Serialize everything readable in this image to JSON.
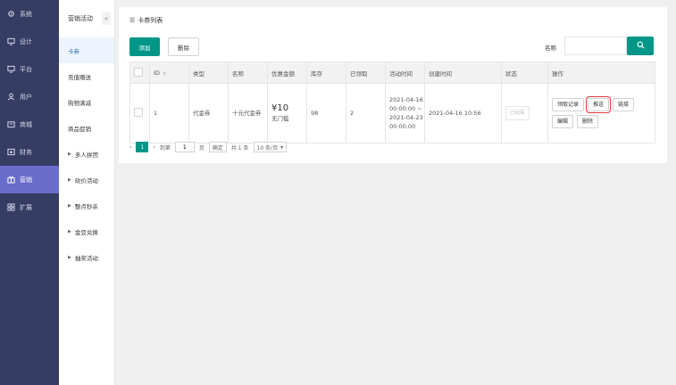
{
  "sidebar": {
    "items": [
      {
        "label": "系统",
        "icon": "gear-icon"
      },
      {
        "label": "设计",
        "icon": "monitor-icon"
      },
      {
        "label": "平台",
        "icon": "monitor-icon"
      },
      {
        "label": "用户",
        "icon": "user-icon"
      },
      {
        "label": "商城",
        "icon": "shop-icon"
      },
      {
        "label": "财务",
        "icon": "wallet-icon"
      },
      {
        "label": "营销",
        "icon": "marketing-icon",
        "active": true
      },
      {
        "label": "扩展",
        "icon": "grid-icon"
      }
    ]
  },
  "subnav": {
    "title": "营销活动",
    "collapse": "«",
    "items": [
      {
        "label": "卡券",
        "active": true,
        "expandable": false
      },
      {
        "label": "充值赠送",
        "expandable": false
      },
      {
        "label": "购物满减",
        "expandable": false
      },
      {
        "label": "商品促销",
        "expandable": false
      },
      {
        "label": "多人拼团",
        "expandable": true
      },
      {
        "label": "砍价活动",
        "expandable": true
      },
      {
        "label": "整点秒杀",
        "expandable": true
      },
      {
        "label": "金豆兑换",
        "expandable": true
      },
      {
        "label": "抽奖活动",
        "expandable": true
      }
    ]
  },
  "main": {
    "title": "卡券列表",
    "add_label": "添加",
    "delete_label": "删除",
    "search_label": "名称",
    "search_value": "",
    "search_placeholder": ""
  },
  "table": {
    "headers": [
      "ID",
      "类型",
      "名称",
      "优惠金额",
      "库存",
      "已领取",
      "活动时间",
      "创建时间",
      "状态",
      "操作"
    ],
    "rows": [
      {
        "id": "1",
        "type": "代金券",
        "name": "十元代金券",
        "amount": "¥10",
        "condition": "无门槛",
        "stock": "98",
        "received": "2",
        "activity_time": "2021-04-16 00:00:00 ~ 2021-04-23 00:00:00",
        "created": "2021-04-16 10:56",
        "status": "已结束",
        "actions": {
          "records": "领取记录",
          "push": "推送",
          "link": "链接",
          "edit": "编辑",
          "delete": "删除"
        }
      }
    ]
  },
  "pager": {
    "prev": "‹",
    "current": "1",
    "next": "›",
    "goto_label": "到第",
    "goto_value": "1",
    "page_unit": "页",
    "confirm": "确定",
    "total": "共 1 条",
    "page_size": "10 条/页"
  },
  "colors": {
    "accent": "#009688",
    "sidebar": "#353d63",
    "sidebar_active": "#6a6cc9",
    "highlight": "#e03a3a"
  }
}
